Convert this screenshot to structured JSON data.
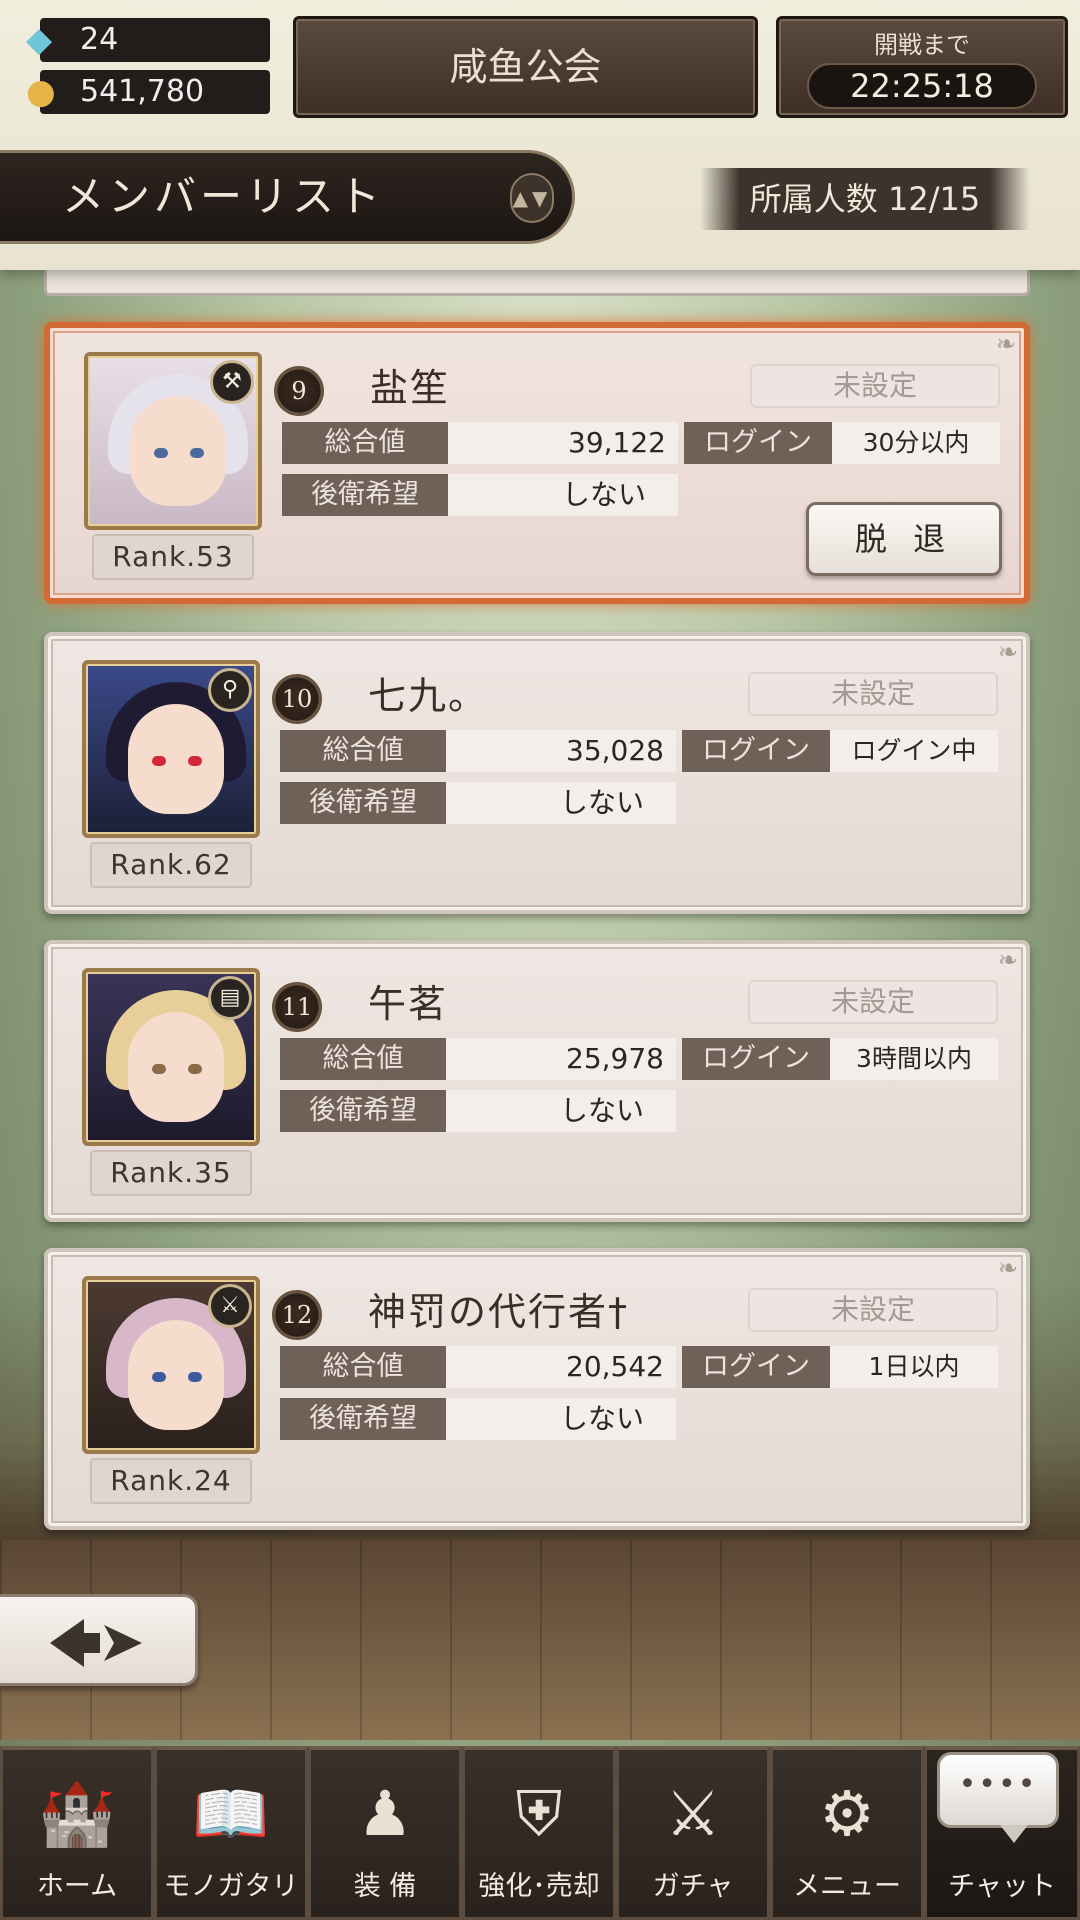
{
  "header": {
    "gems": "24",
    "gold": "541,780",
    "guild_name": "咸鱼公会",
    "timer_label": "開戦まで",
    "timer_value": "22:25:18",
    "list_title": "メンバーリスト",
    "member_count": "所属人数 12/15"
  },
  "labels": {
    "total": "総合値",
    "rear": "後衛希望",
    "login": "ログイン",
    "status_unset": "未設定",
    "leave": "脱 退"
  },
  "members": [
    {
      "order": "9",
      "name": "盐笙",
      "rank": "Rank.53",
      "total": "39,122",
      "rear": "しない",
      "login": "30分以内",
      "role_icon": "hammer-icon"
    },
    {
      "order": "10",
      "name": "七九。",
      "rank": "Rank.62",
      "total": "35,028",
      "rear": "しない",
      "login": "ログイン中",
      "role_icon": "staff-icon"
    },
    {
      "order": "11",
      "name": "午茗",
      "rank": "Rank.35",
      "total": "25,978",
      "rear": "しない",
      "login": "3時間以内",
      "role_icon": "book-icon"
    },
    {
      "order": "12",
      "name": "神罚の代行者†",
      "rank": "Rank.24",
      "total": "20,542",
      "rear": "しない",
      "login": "1日以内",
      "role_icon": "sword-icon"
    }
  ],
  "nav": [
    {
      "label": "ホーム",
      "icon": "castle-icon"
    },
    {
      "label": "モノガタリ",
      "icon": "book-icon"
    },
    {
      "label": "装 備",
      "icon": "puppet-icon"
    },
    {
      "label": "強化･売却",
      "icon": "shield-icon"
    },
    {
      "label": "ガチャ",
      "icon": "crossed-swords-icon"
    },
    {
      "label": "メニュー",
      "icon": "gears-icon"
    },
    {
      "label": "チャット",
      "icon": "chat-bubble-icon"
    }
  ],
  "chat_bubble_text": "••••",
  "colors": {
    "selected_border": "#d16a33",
    "stat_key_bg": "#6f6158",
    "nav_bg": "#2a221d"
  }
}
